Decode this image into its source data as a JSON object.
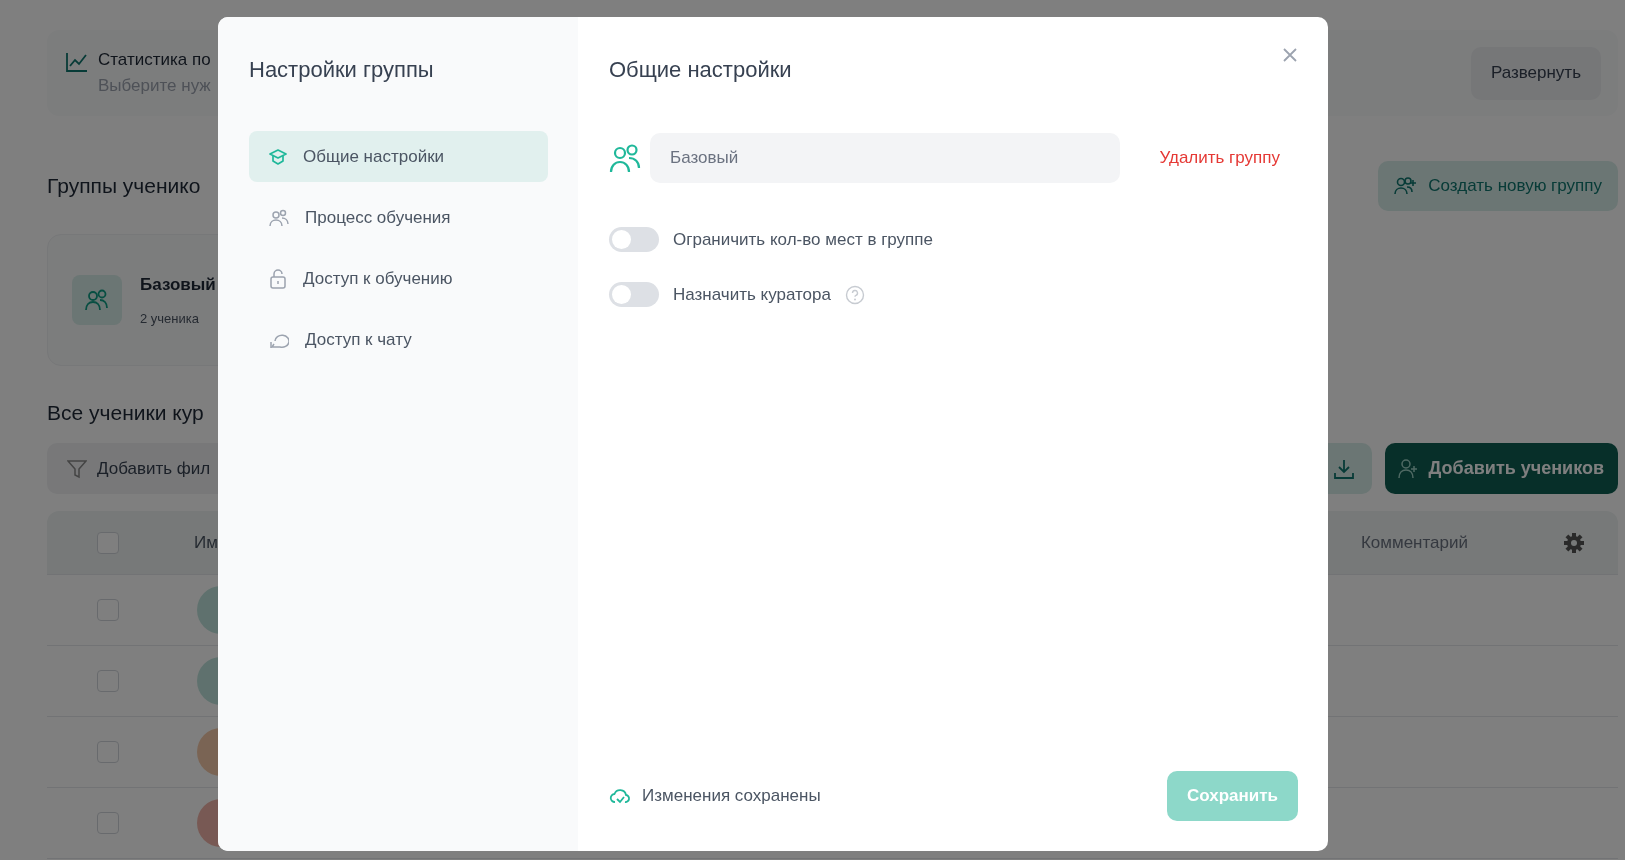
{
  "background": {
    "stats": {
      "title": "Статистика по",
      "subtitle": "Выберите нуж",
      "expand_button": "Развернуть"
    },
    "groups": {
      "heading": "Группы ученико",
      "create_button": "Создать новую группу",
      "cards": [
        {
          "name": "Базовый",
          "count": "2 ученика"
        }
      ]
    },
    "students": {
      "heading": "Все ученики кур",
      "filter_button": "Добавить фил",
      "add_button": "Добавить учеников",
      "columns": [
        "Им",
        "Комментарий"
      ],
      "header_checked": false,
      "rows": [
        {
          "checked": false
        },
        {
          "checked": false
        },
        {
          "checked": false
        },
        {
          "checked": false
        }
      ]
    }
  },
  "modal": {
    "sidebar": {
      "title": "Настройки группы",
      "items": [
        {
          "label": "Общие настройки",
          "selected": true
        },
        {
          "label": "Процесс обучения",
          "selected": false
        },
        {
          "label": "Доступ к обучению",
          "selected": false
        },
        {
          "label": "Доступ к чату",
          "selected": false
        }
      ]
    },
    "title": "Общие настройки",
    "group_name": {
      "value": "Базовый"
    },
    "delete_link": "Удалить группу",
    "toggles": [
      {
        "label": "Ограничить кол-во мест в группе",
        "on": false,
        "help": false
      },
      {
        "label": "Назначить куратора",
        "on": false,
        "help": true
      }
    ],
    "status": "Изменения сохранены",
    "save_button": {
      "label": "Сохранить",
      "disabled": true
    }
  }
}
